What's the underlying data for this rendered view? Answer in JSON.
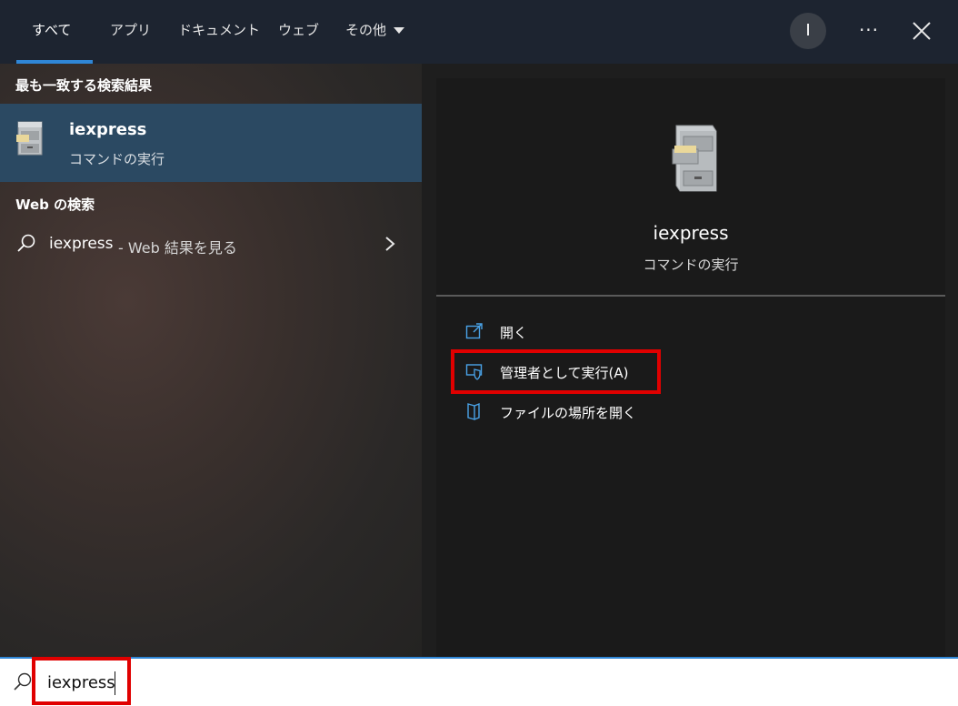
{
  "tabs": [
    {
      "label": "すべて"
    },
    {
      "label": "アプリ"
    },
    {
      "label": "ドキュメント"
    },
    {
      "label": "ウェブ"
    },
    {
      "label": "その他"
    }
  ],
  "user_initial": "I",
  "more_glyph": "···",
  "left": {
    "best_match_title": "最も一致する検索結果",
    "best_match": {
      "name": "iexpress",
      "type": "コマンドの実行"
    },
    "web_title": "Web の検索",
    "web_result": {
      "term": "iexpress",
      "suffix": "- Web 結果を見る"
    }
  },
  "right": {
    "app_name": "iexpress",
    "app_type": "コマンドの実行",
    "actions": [
      {
        "label": "開く",
        "icon": "open-icon"
      },
      {
        "label": "管理者として実行(A)",
        "icon": "shield-icon"
      },
      {
        "label": "ファイルの場所を開く",
        "icon": "folder-location-icon"
      }
    ]
  },
  "search": {
    "value": "iexpress"
  },
  "colors": {
    "accent": "#2f86d6",
    "highlight": "#e00000",
    "selected_row": "#2b4962"
  }
}
